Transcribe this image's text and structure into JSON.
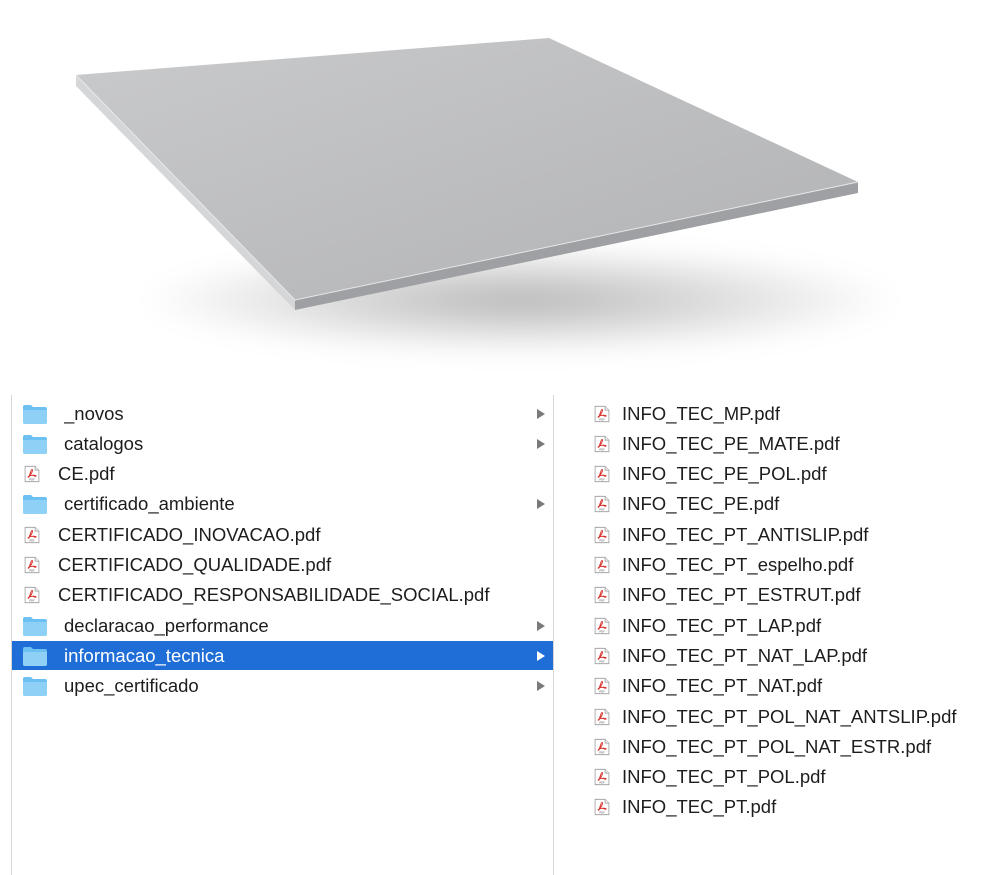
{
  "product_image": {
    "icon": "porcelain-tile-render",
    "tile_color": "#bdbec0"
  },
  "finder": {
    "left_column": [
      {
        "label": "_novos",
        "type": "folder",
        "has_children": true,
        "selected": false
      },
      {
        "label": "catalogos",
        "type": "folder",
        "has_children": true,
        "selected": false
      },
      {
        "label": "CE.pdf",
        "type": "pdf",
        "has_children": false,
        "selected": false
      },
      {
        "label": "certificado_ambiente",
        "type": "folder",
        "has_children": true,
        "selected": false
      },
      {
        "label": "CERTIFICADO_INOVACAO.pdf",
        "type": "pdf",
        "has_children": false,
        "selected": false
      },
      {
        "label": "CERTIFICADO_QUALIDADE.pdf",
        "type": "pdf",
        "has_children": false,
        "selected": false
      },
      {
        "label": "CERTIFICADO_RESPONSABILIDADE_SOCIAL.pdf",
        "type": "pdf",
        "has_children": false,
        "selected": false
      },
      {
        "label": "declaracao_performance",
        "type": "folder",
        "has_children": true,
        "selected": false
      },
      {
        "label": "informacao_tecnica",
        "type": "folder",
        "has_children": true,
        "selected": true
      },
      {
        "label": "upec_certificado",
        "type": "folder",
        "has_children": true,
        "selected": false
      }
    ],
    "right_column": [
      {
        "label": "INFO_TEC_MP.pdf",
        "type": "pdf"
      },
      {
        "label": "INFO_TEC_PE_MATE.pdf",
        "type": "pdf"
      },
      {
        "label": "INFO_TEC_PE_POL.pdf",
        "type": "pdf"
      },
      {
        "label": "INFO_TEC_PE.pdf",
        "type": "pdf"
      },
      {
        "label": "INFO_TEC_PT_ANTISLIP.pdf",
        "type": "pdf"
      },
      {
        "label": "INFO_TEC_PT_espelho.pdf",
        "type": "pdf"
      },
      {
        "label": "INFO_TEC_PT_ESTRUT.pdf",
        "type": "pdf"
      },
      {
        "label": "INFO_TEC_PT_LAP.pdf",
        "type": "pdf"
      },
      {
        "label": "INFO_TEC_PT_NAT_LAP.pdf",
        "type": "pdf"
      },
      {
        "label": "INFO_TEC_PT_NAT.pdf",
        "type": "pdf"
      },
      {
        "label": "INFO_TEC_PT_POL_NAT_ANTSLIP.pdf",
        "type": "pdf"
      },
      {
        "label": "INFO_TEC_PT_POL_NAT_ESTR.pdf",
        "type": "pdf"
      },
      {
        "label": "INFO_TEC_PT_POL.pdf",
        "type": "pdf"
      },
      {
        "label": "INFO_TEC_PT.pdf",
        "type": "pdf"
      }
    ],
    "colors": {
      "selection": "#1f6ed8",
      "folder": "#6cc0f2",
      "pdf_icon_red": "#d8352f",
      "chevron": "#7a7a7a"
    }
  }
}
